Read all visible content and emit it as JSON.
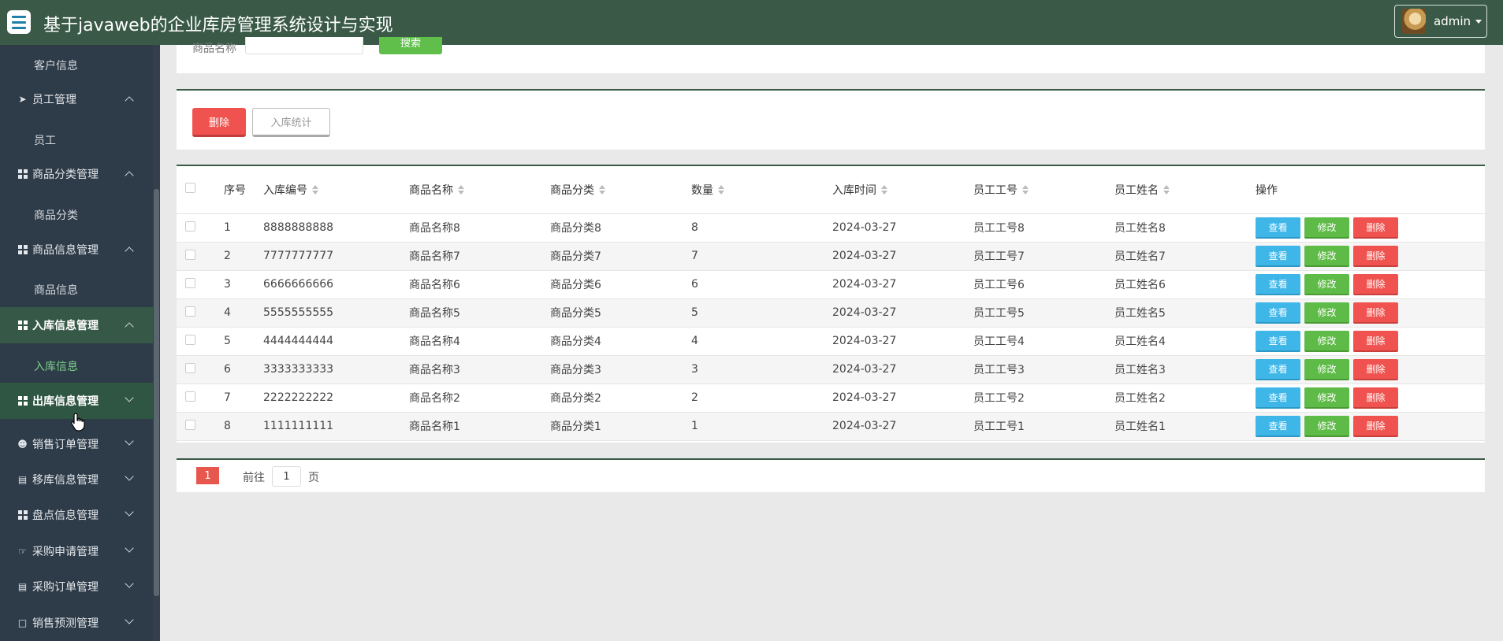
{
  "header": {
    "title": "基于javaweb的企业库房管理系统设计与实现",
    "user": "admin"
  },
  "sidebar": {
    "items": [
      {
        "kind": "sub",
        "label": "客户信息"
      },
      {
        "kind": "group",
        "label": "员工管理",
        "icon": "send-icon",
        "state": "up"
      },
      {
        "kind": "sub",
        "label": "员工"
      },
      {
        "kind": "group",
        "label": "商品分类管理",
        "icon": "grid-icon",
        "state": "up"
      },
      {
        "kind": "sub",
        "label": "商品分类"
      },
      {
        "kind": "group",
        "label": "商品信息管理",
        "icon": "grid-icon",
        "state": "up"
      },
      {
        "kind": "sub",
        "label": "商品信息"
      },
      {
        "kind": "group",
        "label": "入库信息管理",
        "icon": "grid-icon",
        "state": "up",
        "active": true
      },
      {
        "kind": "sub",
        "label": "入库信息",
        "active": true
      },
      {
        "kind": "group",
        "label": "出库信息管理",
        "icon": "grid-icon",
        "state": "down",
        "hover": true
      },
      {
        "kind": "group",
        "label": "销售订单管理",
        "icon": "user-icon",
        "state": "down"
      },
      {
        "kind": "group",
        "label": "移库信息管理",
        "icon": "clipboard-icon",
        "state": "down"
      },
      {
        "kind": "group",
        "label": "盘点信息管理",
        "icon": "grid-icon",
        "state": "down"
      },
      {
        "kind": "group",
        "label": "采购申请管理",
        "icon": "thumbs-up-icon",
        "state": "down"
      },
      {
        "kind": "group",
        "label": "采购订单管理",
        "icon": "clipboard-icon",
        "state": "down"
      },
      {
        "kind": "group",
        "label": "销售预测管理",
        "icon": "comment-icon",
        "state": "down"
      }
    ]
  },
  "search": {
    "label": "商品名称",
    "placeholder": "商品名称",
    "button": "搜索"
  },
  "toolbar": {
    "delete": "删除",
    "stats": "入库统计"
  },
  "table": {
    "headers": [
      "序号",
      "入库编号",
      "商品名称",
      "商品分类",
      "数量",
      "入库时间",
      "员工工号",
      "员工姓名",
      "操作"
    ],
    "rows": [
      [
        "1",
        "8888888888",
        "商品名称8",
        "商品分类8",
        "8",
        "2024-03-27",
        "员工工号8",
        "员工姓名8"
      ],
      [
        "2",
        "7777777777",
        "商品名称7",
        "商品分类7",
        "7",
        "2024-03-27",
        "员工工号7",
        "员工姓名7"
      ],
      [
        "3",
        "6666666666",
        "商品名称6",
        "商品分类6",
        "6",
        "2024-03-27",
        "员工工号6",
        "员工姓名6"
      ],
      [
        "4",
        "5555555555",
        "商品名称5",
        "商品分类5",
        "5",
        "2024-03-27",
        "员工工号5",
        "员工姓名5"
      ],
      [
        "5",
        "4444444444",
        "商品名称4",
        "商品分类4",
        "4",
        "2024-03-27",
        "员工工号4",
        "员工姓名4"
      ],
      [
        "6",
        "3333333333",
        "商品名称3",
        "商品分类3",
        "3",
        "2024-03-27",
        "员工工号3",
        "员工姓名3"
      ],
      [
        "7",
        "2222222222",
        "商品名称2",
        "商品分类2",
        "2",
        "2024-03-27",
        "员工工号2",
        "员工姓名2"
      ],
      [
        "8",
        "1111111111",
        "商品名称1",
        "商品分类1",
        "1",
        "2024-03-27",
        "员工工号1",
        "员工姓名1"
      ]
    ],
    "actions": {
      "view": "查看",
      "edit": "修改",
      "delete": "删除"
    }
  },
  "pager": {
    "current": "1",
    "goto_label": "前往",
    "goto_value": "1",
    "goto_suffix": "页"
  },
  "colors": {
    "header_bg": "#3a5a47",
    "sidebar_bg": "#2e3b48",
    "active_green": "#7dd08a",
    "btn_view": "#3fb6e8",
    "btn_edit": "#5fbb47",
    "btn_delete": "#f0534f"
  }
}
